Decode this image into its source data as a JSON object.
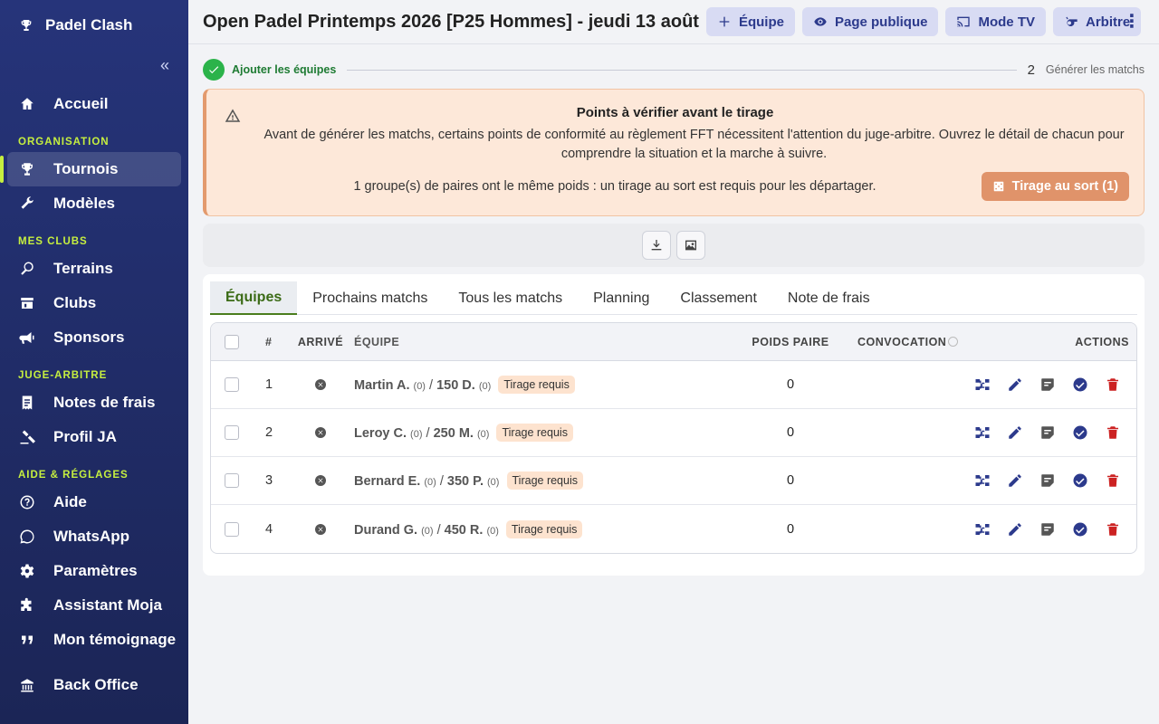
{
  "app": {
    "name": "Padel Clash"
  },
  "sidebar": {
    "items_top": [
      {
        "label": "Accueil",
        "icon": "home-icon"
      }
    ],
    "sections": [
      {
        "title": "ORGANISATION",
        "items": [
          {
            "label": "Tournois",
            "icon": "trophy-icon",
            "active": true
          },
          {
            "label": "Modèles",
            "icon": "wrench-icon"
          }
        ]
      },
      {
        "title": "MES CLUBS",
        "items": [
          {
            "label": "Terrains",
            "icon": "racket-icon"
          },
          {
            "label": "Clubs",
            "icon": "store-icon"
          },
          {
            "label": "Sponsors",
            "icon": "megaphone-icon"
          }
        ]
      },
      {
        "title": "JUGE-ARBITRE",
        "items": [
          {
            "label": "Notes de frais",
            "icon": "receipt-icon"
          },
          {
            "label": "Profil JA",
            "icon": "gavel-icon"
          }
        ]
      },
      {
        "title": "AIDE & RÉGLAGES",
        "items": [
          {
            "label": "Aide",
            "icon": "help-icon"
          },
          {
            "label": "WhatsApp",
            "icon": "whatsapp-icon"
          },
          {
            "label": "Paramètres",
            "icon": "gear-icon"
          },
          {
            "label": "Assistant Moja",
            "icon": "puzzle-icon"
          },
          {
            "label": "Mon témoignage",
            "icon": "quote-icon"
          },
          {
            "label": "Back Office",
            "icon": "building-icon"
          }
        ]
      }
    ]
  },
  "header": {
    "title": "Open Padel Printemps 2026 [P25 Hommes] - jeudi 13 août",
    "buttons": [
      {
        "label": "Équipe",
        "icon": "plus-icon"
      },
      {
        "label": "Page publique",
        "icon": "eye-icon"
      },
      {
        "label": "Mode TV",
        "icon": "cast-icon"
      },
      {
        "label": "Arbitre",
        "icon": "whistle-icon"
      }
    ]
  },
  "stepper": {
    "step1": "Ajouter les équipes",
    "step2_num": "2",
    "step2": "Générer les matchs"
  },
  "alert": {
    "title": "Points à vérifier avant le tirage",
    "body": "Avant de générer les matchs, certains points de conformité au règlement FFT nécessitent l'attention du juge-arbitre. Ouvrez le détail de chacun pour comprendre la situation et la marche à suivre.",
    "line": "1 groupe(s) de paires ont le même poids : un tirage au sort est requis pour les départager.",
    "button": "Tirage au sort (1)"
  },
  "tabs": [
    "Équipes",
    "Prochains matchs",
    "Tous les matchs",
    "Planning",
    "Classement",
    "Note de frais"
  ],
  "table": {
    "headers": {
      "num": "#",
      "arrive": "ARRIVÉ",
      "equipe": "ÉQUIPE",
      "poids": "POIDS PAIRE",
      "convocation": "CONVOCATION",
      "actions": "ACTIONS"
    },
    "rows": [
      {
        "num": "1",
        "p1": "Martin A.",
        "p1_pts": "(0)",
        "p2": "150 D.",
        "p2_pts": "(0)",
        "badge": "Tirage requis",
        "poids": "0"
      },
      {
        "num": "2",
        "p1": "Leroy C.",
        "p1_pts": "(0)",
        "p2": "250 M.",
        "p2_pts": "(0)",
        "badge": "Tirage requis",
        "poids": "0"
      },
      {
        "num": "3",
        "p1": "Bernard E.",
        "p1_pts": "(0)",
        "p2": "350 P.",
        "p2_pts": "(0)",
        "badge": "Tirage requis",
        "poids": "0"
      },
      {
        "num": "4",
        "p1": "Durand G.",
        "p1_pts": "(0)",
        "p2": "450 R.",
        "p2_pts": "(0)",
        "badge": "Tirage requis",
        "poids": "0"
      }
    ]
  },
  "colors": {
    "accent": "#2c3a8c",
    "lime": "#c6ef3f",
    "danger": "#cc2222",
    "success": "#2bb34a"
  }
}
